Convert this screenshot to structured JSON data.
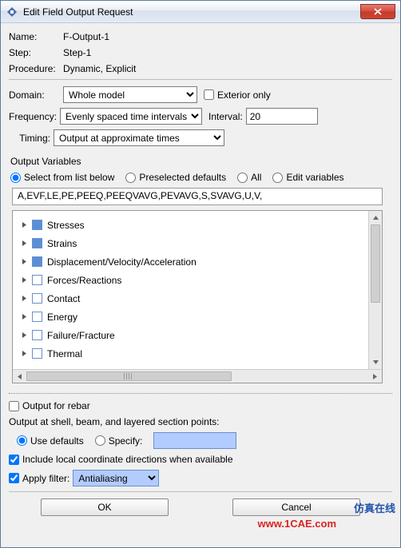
{
  "window": {
    "title": "Edit Field Output Request"
  },
  "meta": {
    "name_label": "Name:",
    "name_value": "F-Output-1",
    "step_label": "Step:",
    "step_value": "Step-1",
    "proc_label": "Procedure:",
    "proc_value": "Dynamic, Explicit"
  },
  "domain": {
    "label": "Domain:",
    "value": "Whole model",
    "exterior_checked": false,
    "exterior_label": "Exterior only"
  },
  "frequency": {
    "label": "Frequency:",
    "value": "Evenly spaced time intervals",
    "interval_label": "Interval:",
    "interval_value": "20"
  },
  "timing": {
    "label": "Timing:",
    "value": "Output at approximate times"
  },
  "outvars": {
    "title": "Output Variables",
    "radios": {
      "select": "Select from list below",
      "preselected": "Preselected defaults",
      "all": "All",
      "edit": "Edit variables"
    },
    "selected_radio": "select",
    "varlist": "A,EVF,LE,PE,PEEQ,PEEQVAVG,PEVAVG,S,SVAVG,U,V,",
    "tree": [
      {
        "label": "Stresses",
        "checked": true,
        "expandable": true
      },
      {
        "label": "Strains",
        "checked": true,
        "expandable": true
      },
      {
        "label": "Displacement/Velocity/Acceleration",
        "checked": true,
        "expandable": true
      },
      {
        "label": "Forces/Reactions",
        "checked": false,
        "expandable": true
      },
      {
        "label": "Contact",
        "checked": false,
        "expandable": true
      },
      {
        "label": "Energy",
        "checked": false,
        "expandable": true
      },
      {
        "label": "Failure/Fracture",
        "checked": false,
        "expandable": true
      },
      {
        "label": "Thermal",
        "checked": false,
        "expandable": true
      }
    ]
  },
  "lower": {
    "rebar_checked": false,
    "rebar_label": "Output for rebar",
    "section_pts_label": "Output at shell, beam, and layered section points:",
    "use_defaults": "Use defaults",
    "specify": "Specify:",
    "section_radio": "use_defaults",
    "include_local_checked": true,
    "include_local_label": "Include local coordinate directions when available",
    "apply_filter_checked": true,
    "apply_filter_label": "Apply filter:",
    "apply_filter_value": "Antialiasing"
  },
  "buttons": {
    "ok": "OK",
    "cancel": "Cancel"
  },
  "watermarks": {
    "bg": "1CAE.COM",
    "url": "www.1CAE.com",
    "cn": "仿真在线"
  }
}
